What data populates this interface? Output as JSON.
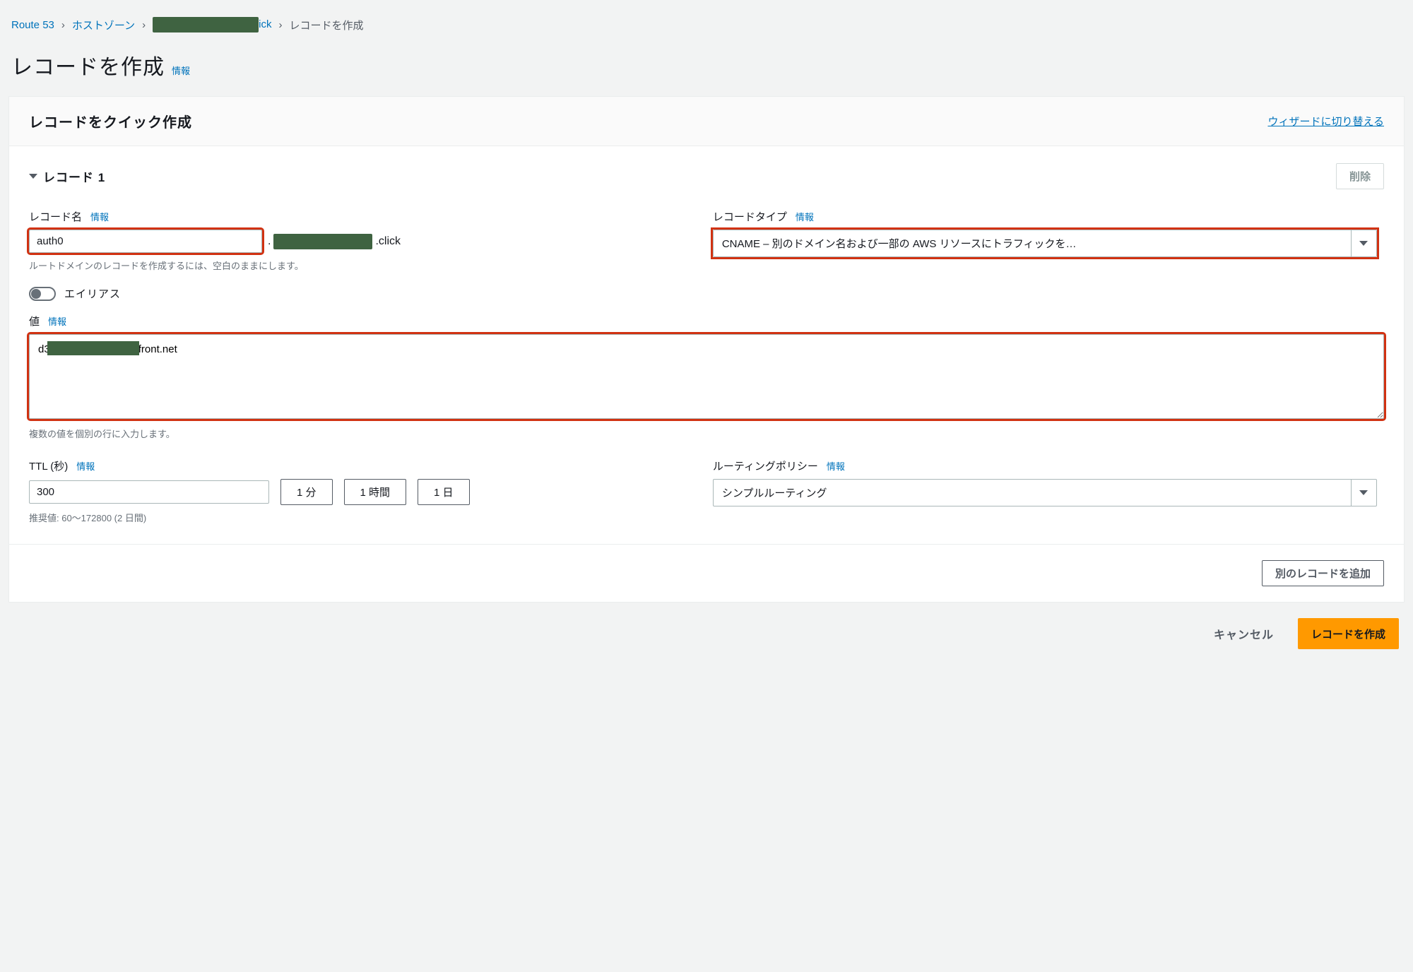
{
  "breadcrumb": {
    "service": "Route 53",
    "hosted_zones": "ホストゾーン",
    "domain_suffix": "ick",
    "current": "レコードを作成"
  },
  "page": {
    "title": "レコードを作成",
    "info": "情報"
  },
  "panel": {
    "title": "レコードをクイック作成",
    "wizard_link": "ウィザードに切り替える"
  },
  "record": {
    "header": "レコード 1",
    "delete": "削除",
    "name_label": "レコード名",
    "name_info": "情報",
    "name_value": "auth0",
    "domain_prefix_dot": ".",
    "domain_suffix": ".click",
    "name_hint": "ルートドメインのレコードを作成するには、空白のままにします。",
    "type_label": "レコードタイプ",
    "type_info": "情報",
    "type_value": "CNAME – 別のドメイン名および一部の AWS リソースにトラフィックを…",
    "alias_label": "エイリアス",
    "value_label": "値",
    "value_info": "情報",
    "value_text": "d3                          udfront.net",
    "value_hint": "複数の値を個別の行に入力します。",
    "ttl_label": "TTL (秒)",
    "ttl_info": "情報",
    "ttl_value": "300",
    "ttl_1m": "1 分",
    "ttl_1h": "1 時間",
    "ttl_1d": "1 日",
    "ttl_hint": "推奨値: 60〜172800 (2 日間)",
    "routing_label": "ルーティングポリシー",
    "routing_info": "情報",
    "routing_value": "シンプルルーティング"
  },
  "footer": {
    "add_record": "別のレコードを追加",
    "cancel": "キャンセル",
    "create": "レコードを作成"
  }
}
